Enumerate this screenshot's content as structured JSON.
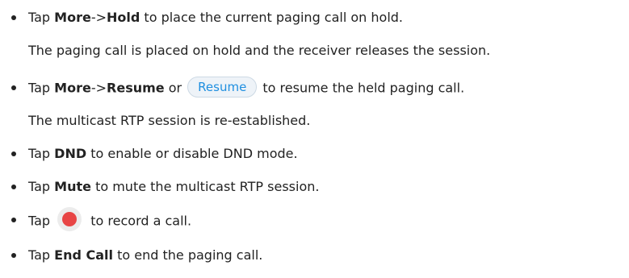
{
  "items": [
    {
      "tap": "Tap ",
      "b1": "More",
      "sep": "->",
      "b2": "Hold",
      "rest": " to place the current paging call on hold.",
      "sub": "The paging call is placed on hold and the receiver releases the session."
    },
    {
      "tap": "Tap ",
      "b1": "More",
      "sep": "->",
      "b2": "Resume",
      "or": " or ",
      "button_label": "Resume",
      "rest": " to resume the held paging call.",
      "sub": "The multicast RTP session is re-established."
    },
    {
      "tap": "Tap ",
      "b1": "DND",
      "rest": " to enable or disable DND mode."
    },
    {
      "tap": "Tap ",
      "b1": "Mute",
      "rest": " to mute the multicast RTP session."
    },
    {
      "tap": "Tap ",
      "icon": "record-icon",
      "rest": " to record a call."
    },
    {
      "tap": "Tap ",
      "b1": "End Call",
      "rest": " to end the paging call."
    }
  ],
  "colors": {
    "text": "#222222",
    "resume_button_text": "#1f8fe0",
    "record_dot": "#e84545"
  }
}
